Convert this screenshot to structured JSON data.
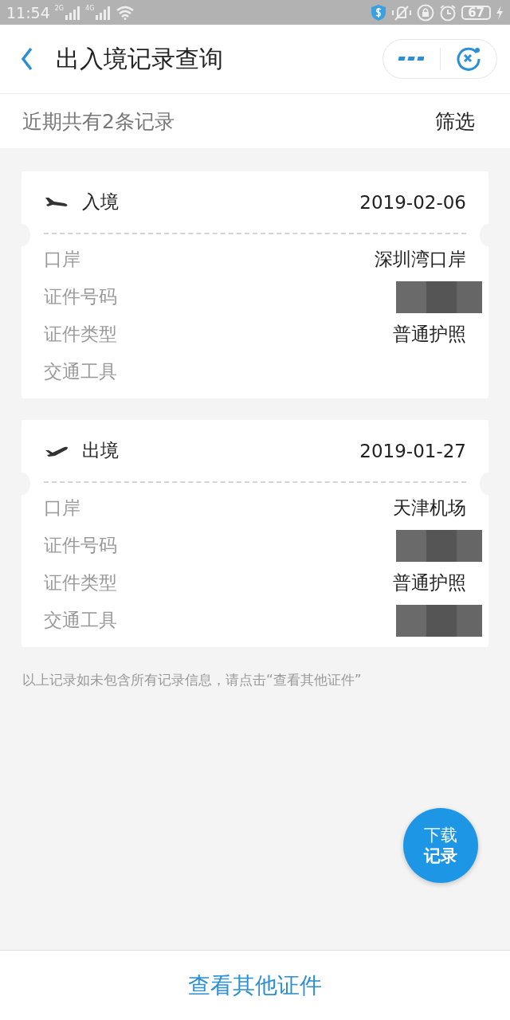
{
  "status_bar": {
    "time": "11:54",
    "networks": [
      "2G",
      "4G"
    ],
    "battery": "67"
  },
  "header": {
    "title": "出入境记录查询"
  },
  "summary": {
    "text": "近期共有2条记录",
    "filter": "筛选"
  },
  "records": [
    {
      "kind": "entry",
      "type": "入境",
      "date": "2019-02-06",
      "fields": [
        {
          "label": "口岸",
          "value": "深圳湾口岸"
        },
        {
          "label": "证件号码",
          "redacted": true
        },
        {
          "label": "证件类型",
          "value": "普通护照"
        },
        {
          "label": "交通工具"
        }
      ]
    },
    {
      "kind": "exit",
      "type": "出境",
      "date": "2019-01-27",
      "fields": [
        {
          "label": "口岸",
          "value": "天津机场"
        },
        {
          "label": "证件号码",
          "redacted": true
        },
        {
          "label": "证件类型",
          "value": "普通护照"
        },
        {
          "label": "交通工具",
          "redacted": true
        }
      ]
    }
  ],
  "note": "以上记录如未包含所有记录信息，请点击“查看其他证件”",
  "fab": {
    "line_1": "下载",
    "line_2": "记录"
  },
  "bottom_button": "查看其他证件"
}
